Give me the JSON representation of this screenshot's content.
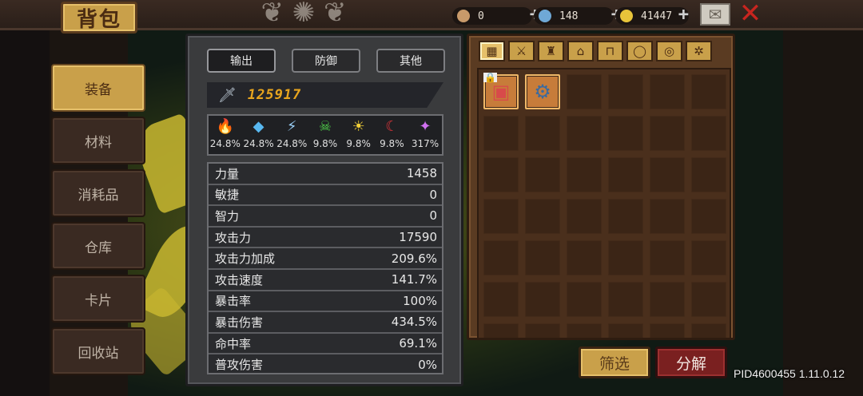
{
  "header": {
    "title": "背包",
    "resources": [
      {
        "name": "resource-a",
        "value": "0",
        "color": "#c89a6a"
      },
      {
        "name": "resource-b",
        "value": "148",
        "color": "#6fa8d6"
      },
      {
        "name": "resource-gold",
        "value": "41447",
        "color": "#e8c43a"
      }
    ],
    "mail_icon": "mail-icon",
    "close_icon": "close-icon"
  },
  "sidebar": {
    "items": [
      {
        "label": "装备",
        "active": true
      },
      {
        "label": "材料",
        "active": false
      },
      {
        "label": "消耗品",
        "active": false
      },
      {
        "label": "仓库",
        "active": false
      },
      {
        "label": "卡片",
        "active": false
      },
      {
        "label": "回收站",
        "active": false
      }
    ]
  },
  "stats": {
    "tabs": [
      {
        "label": "输出",
        "active": true
      },
      {
        "label": "防御",
        "active": false
      },
      {
        "label": "其他",
        "active": false
      }
    ],
    "power": "125917",
    "elements": [
      {
        "icon": "fire-icon",
        "glyph": "🔥",
        "value": "24.8%"
      },
      {
        "icon": "ice-icon",
        "glyph": "◆",
        "value": "24.8%"
      },
      {
        "icon": "lightning-icon",
        "glyph": "⚡",
        "value": "24.8%"
      },
      {
        "icon": "poison-skull-icon",
        "glyph": "☠",
        "value": "9.8%"
      },
      {
        "icon": "light-sun-icon",
        "glyph": "☀",
        "value": "9.8%"
      },
      {
        "icon": "dark-moon-icon",
        "glyph": "☾",
        "value": "9.8%"
      },
      {
        "icon": "arcane-star-icon",
        "glyph": "✦",
        "value": "317%"
      }
    ],
    "rows": [
      {
        "label": "力量",
        "value": "1458"
      },
      {
        "label": "敏捷",
        "value": "0"
      },
      {
        "label": "智力",
        "value": "0"
      },
      {
        "label": "攻击力",
        "value": "17590"
      },
      {
        "label": "攻击力加成",
        "value": "209.6%"
      },
      {
        "label": "攻击速度",
        "value": "141.7%"
      },
      {
        "label": "暴击率",
        "value": "100%"
      },
      {
        "label": "暴击伤害",
        "value": "434.5%"
      },
      {
        "label": "命中率",
        "value": "69.1%"
      },
      {
        "label": "普攻伤害",
        "value": "0%"
      }
    ]
  },
  "inventory": {
    "categories": [
      {
        "icon": "all-grid-icon",
        "glyph": "▦",
        "active": true
      },
      {
        "icon": "weapon-sword-icon",
        "glyph": "⚔",
        "active": false
      },
      {
        "icon": "armor-icon",
        "glyph": "♜",
        "active": false
      },
      {
        "icon": "helmet-icon",
        "glyph": "⌂",
        "active": false
      },
      {
        "icon": "boots-icon",
        "glyph": "⊓",
        "active": false
      },
      {
        "icon": "necklace-icon",
        "glyph": "◯",
        "active": false
      },
      {
        "icon": "ring-icon",
        "glyph": "◎",
        "active": false
      },
      {
        "icon": "gear-settings-icon",
        "glyph": "✲",
        "active": false
      }
    ],
    "items": [
      {
        "icon": "chest-armor-item-icon",
        "glyph": "▣",
        "locked": true
      },
      {
        "icon": "gear-ring-item-icon",
        "glyph": "⚙",
        "locked": false
      }
    ],
    "filter_label": "筛选",
    "decompose_label": "分解"
  },
  "version": "PID4600455 1.11.0.12"
}
